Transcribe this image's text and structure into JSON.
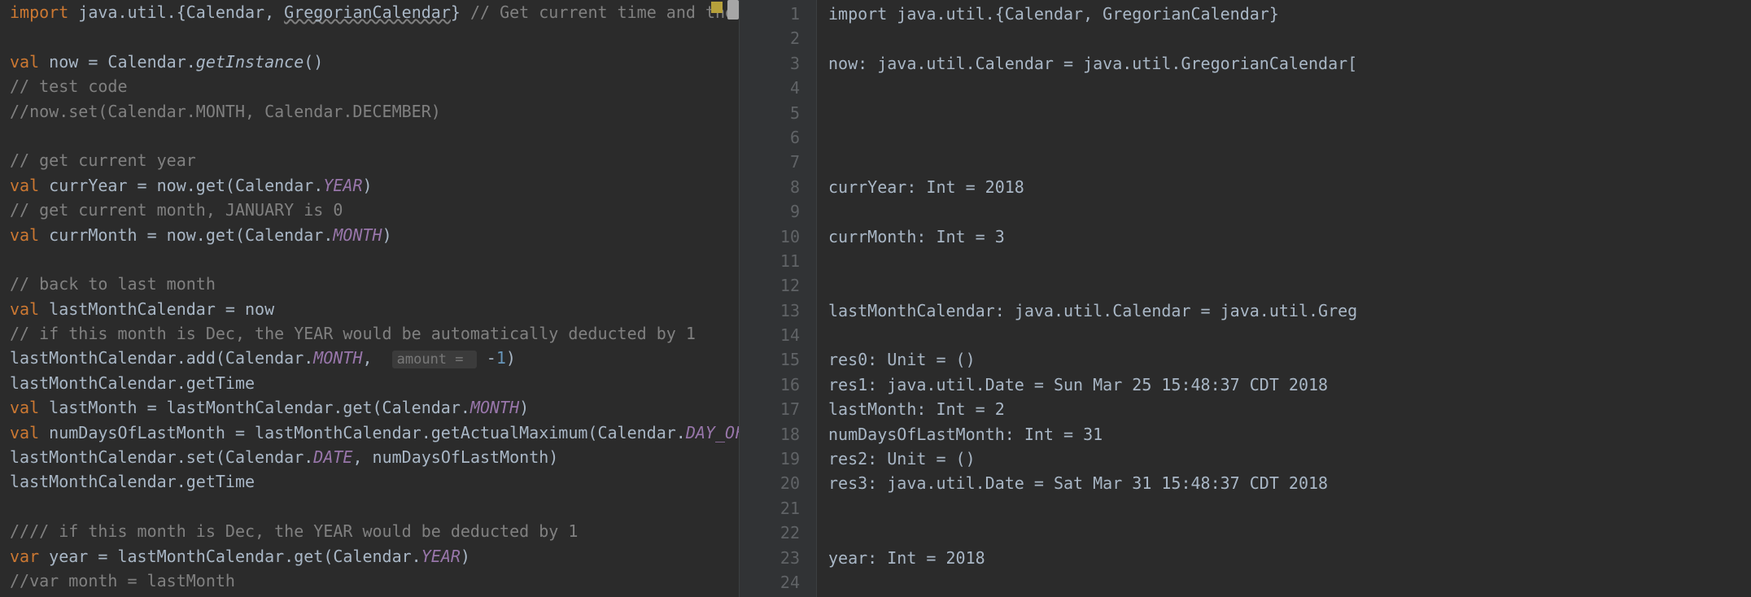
{
  "editor": {
    "lines": [
      [
        {
          "cls": "kw",
          "t": "import"
        },
        {
          "cls": "ident",
          "t": " java.util.{Calendar, "
        },
        {
          "cls": "ident squiggle",
          "t": "GregorianCalendar"
        },
        {
          "cls": "ident",
          "t": "} "
        },
        {
          "cls": "comment",
          "t": "// Get current time and the last date "
        }
      ],
      [],
      [
        {
          "cls": "kw",
          "t": "val"
        },
        {
          "cls": "ident",
          "t": " now = Calendar."
        },
        {
          "cls": "ident italic",
          "t": "getInstance"
        },
        {
          "cls": "ident",
          "t": "()"
        }
      ],
      [
        {
          "cls": "comment",
          "t": "// test code"
        }
      ],
      [
        {
          "cls": "comment",
          "t": "//now.set(Calendar.MONTH, Calendar.DECEMBER)"
        }
      ],
      [],
      [
        {
          "cls": "comment",
          "t": "// get current year"
        }
      ],
      [
        {
          "cls": "kw",
          "t": "val"
        },
        {
          "cls": "ident",
          "t": " currYear = now.get(Calendar."
        },
        {
          "cls": "const",
          "t": "YEAR"
        },
        {
          "cls": "ident",
          "t": ")"
        }
      ],
      [
        {
          "cls": "comment",
          "t": "// get current month, JANUARY is 0"
        }
      ],
      [
        {
          "cls": "kw",
          "t": "val"
        },
        {
          "cls": "ident",
          "t": " currMonth = now.get(Calendar."
        },
        {
          "cls": "const",
          "t": "MONTH"
        },
        {
          "cls": "ident",
          "t": ")"
        }
      ],
      [],
      [
        {
          "cls": "comment",
          "t": "// back to last month"
        }
      ],
      [
        {
          "cls": "kw",
          "t": "val"
        },
        {
          "cls": "ident",
          "t": " lastMonthCalendar = now"
        }
      ],
      [
        {
          "cls": "comment",
          "t": "// if this month is Dec, the YEAR would be automatically deducted by 1"
        }
      ],
      [
        {
          "cls": "ident",
          "t": "lastMonthCalendar.add(Calendar."
        },
        {
          "cls": "const",
          "t": "MONTH"
        },
        {
          "cls": "ident",
          "t": ",  "
        },
        {
          "cls": "hint",
          "t": "amount = "
        },
        {
          "cls": "ident",
          "t": " -"
        },
        {
          "cls": "num",
          "t": "1"
        },
        {
          "cls": "ident",
          "t": ")"
        }
      ],
      [
        {
          "cls": "ident",
          "t": "lastMonthCalendar.getTime"
        }
      ],
      [
        {
          "cls": "kw",
          "t": "val"
        },
        {
          "cls": "ident",
          "t": " lastMonth = lastMonthCalendar.get(Calendar."
        },
        {
          "cls": "const",
          "t": "MONTH"
        },
        {
          "cls": "ident",
          "t": ")"
        }
      ],
      [
        {
          "cls": "kw",
          "t": "val"
        },
        {
          "cls": "ident",
          "t": " numDaysOfLastMonth = lastMonthCalendar.getActualMaximum(Calendar."
        },
        {
          "cls": "const",
          "t": "DAY_OF_MONTH"
        },
        {
          "cls": "ident",
          "t": ")"
        }
      ],
      [
        {
          "cls": "ident",
          "t": "lastMonthCalendar.set(Calendar."
        },
        {
          "cls": "const",
          "t": "DATE"
        },
        {
          "cls": "ident",
          "t": ", numDaysOfLastMonth)"
        }
      ],
      [
        {
          "cls": "ident",
          "t": "lastMonthCalendar.getTime"
        }
      ],
      [],
      [
        {
          "cls": "comment",
          "t": "//// if this month is Dec, the YEAR would be deducted by 1"
        }
      ],
      [
        {
          "cls": "kw",
          "t": "var"
        },
        {
          "cls": "ident",
          "t": " year = lastMonthCalendar.get(Calendar."
        },
        {
          "cls": "const",
          "t": "YEAR"
        },
        {
          "cls": "ident",
          "t": ")"
        }
      ],
      [
        {
          "cls": "comment",
          "t": "//var month = lastMonth"
        }
      ]
    ]
  },
  "gutter": {
    "numbers": [
      "1",
      "2",
      "3",
      "4",
      "5",
      "6",
      "7",
      "8",
      "9",
      "10",
      "11",
      "12",
      "13",
      "14",
      "15",
      "16",
      "17",
      "18",
      "19",
      "20",
      "21",
      "22",
      "23",
      "24"
    ]
  },
  "output": {
    "lines": [
      "import java.util.{Calendar, GregorianCalendar}",
      "",
      "now: java.util.Calendar = java.util.GregorianCalendar[",
      "",
      "",
      "",
      "",
      "currYear: Int = 2018",
      "",
      "currMonth: Int = 3",
      "",
      "",
      "lastMonthCalendar: java.util.Calendar = java.util.Greg",
      "",
      "res0: Unit = ()",
      "res1: java.util.Date = Sun Mar 25 15:48:37 CDT 2018",
      "lastMonth: Int = 2",
      "numDaysOfLastMonth: Int = 31",
      "res2: Unit = ()",
      "res3: java.util.Date = Sat Mar 31 15:48:37 CDT 2018",
      "",
      "",
      "year: Int = 2018",
      ""
    ]
  }
}
